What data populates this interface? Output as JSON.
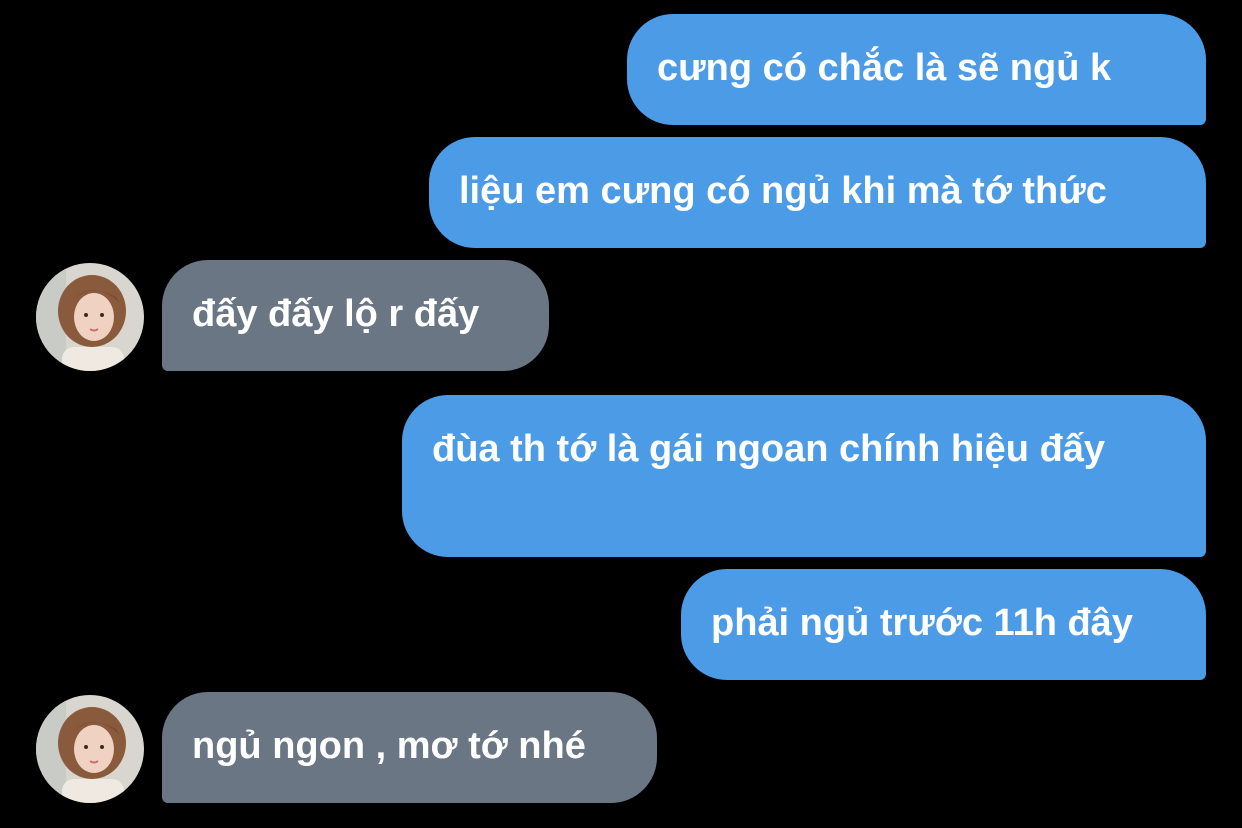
{
  "colors": {
    "background": "#000000",
    "sent_bubble": "#4b9be7",
    "received_bubble": "#6a7684",
    "text": "#ffffff"
  },
  "messages": [
    {
      "sender": "me",
      "text": "cưng có chắc là sẽ ngủ k"
    },
    {
      "sender": "me",
      "text": "liệu em cưng có ngủ khi mà tớ thức"
    },
    {
      "sender": "other",
      "text": "đấy đấy lộ r đấy",
      "avatar": "profile-photo"
    },
    {
      "sender": "me",
      "text": "đùa th tớ là gái ngoan chính hiệu đấy"
    },
    {
      "sender": "me",
      "text": "phải ngủ trước 11h đây"
    },
    {
      "sender": "other",
      "text": "ngủ ngon , mơ tớ nhé",
      "avatar": "profile-photo"
    }
  ]
}
